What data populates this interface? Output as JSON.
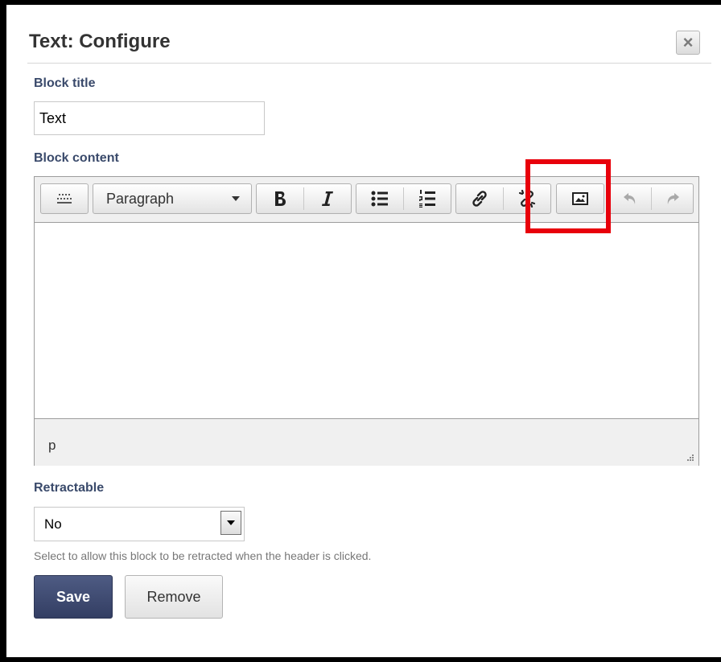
{
  "dialog": {
    "title": "Text: Configure",
    "close_symbol": "×"
  },
  "form": {
    "block_title_label": "Block title",
    "block_title_value": "Text",
    "block_content_label": "Block content",
    "retractable_label": "Retractable",
    "retractable_value": "No",
    "retractable_hint": "Select to allow this block to be retracted when the header is clicked."
  },
  "editor": {
    "format_select": "Paragraph",
    "status_path": "p",
    "toolbar_icons": [
      "toolbar-toggle-icon",
      "bold-icon",
      "italic-icon",
      "bullet-list-icon",
      "numbered-list-icon",
      "link-icon",
      "unlink-icon",
      "image-icon",
      "undo-icon",
      "redo-icon"
    ]
  },
  "buttons": {
    "save": "Save",
    "remove": "Remove"
  },
  "colors": {
    "highlight": "#e8000b",
    "primary_button": "#3a456b",
    "label": "#3a4a6b"
  }
}
